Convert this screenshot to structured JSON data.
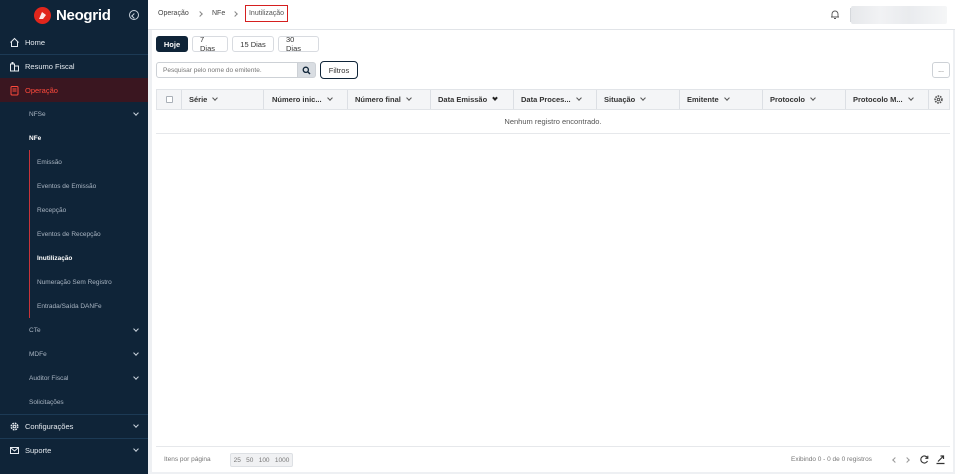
{
  "app": {
    "brand": "Neogrid",
    "accent": "#e1261c",
    "sidebar_bg": "#0f2438"
  },
  "sidebar": {
    "top_items": [
      {
        "label": "Home",
        "icon": "home-icon"
      },
      {
        "label": "Resumo Fiscal",
        "icon": "building-icon"
      },
      {
        "label": "Operação",
        "icon": "document-icon"
      }
    ],
    "operacao_sub": {
      "nfse": "NFSe",
      "nfe": "NFe",
      "nfe_items": [
        "Emissão",
        "Eventos de Emissão",
        "Recepção",
        "Eventos de Recepção",
        "Inutilização",
        "Numeração Sem Registro",
        "Entrada/Saída DANFe"
      ],
      "cte": "CTe",
      "mdfe": "MDFe",
      "auditor": "Auditor Fiscal",
      "solicitacoes": "Solicitações"
    },
    "bottom_items": [
      {
        "label": "Configurações",
        "icon": "gear-icon"
      },
      {
        "label": "Suporte",
        "icon": "mail-icon"
      }
    ]
  },
  "breadcrumb": {
    "items": [
      "Operação",
      "NFe"
    ],
    "current": "Inutilização"
  },
  "periods": [
    "Hoje",
    "7 Dias",
    "15 Dias",
    "30 Dias"
  ],
  "search": {
    "placeholder": "Pesquisar pelo nome do emitente."
  },
  "filters_label": "Filtros",
  "more_label": "...",
  "table": {
    "columns": [
      "Série",
      "Número inic...",
      "Número final",
      "Data Emissão",
      "Data Proces...",
      "Situação",
      "Emitente",
      "Protocolo",
      "Protocolo M..."
    ],
    "empty_message": "Nenhum registro encontrado."
  },
  "footer": {
    "items_per_page": "Itens por página",
    "page_sizes": [
      "25",
      "50",
      "100",
      "1000"
    ],
    "showing": "Exibindo 0 - 0 de 0 registros"
  }
}
